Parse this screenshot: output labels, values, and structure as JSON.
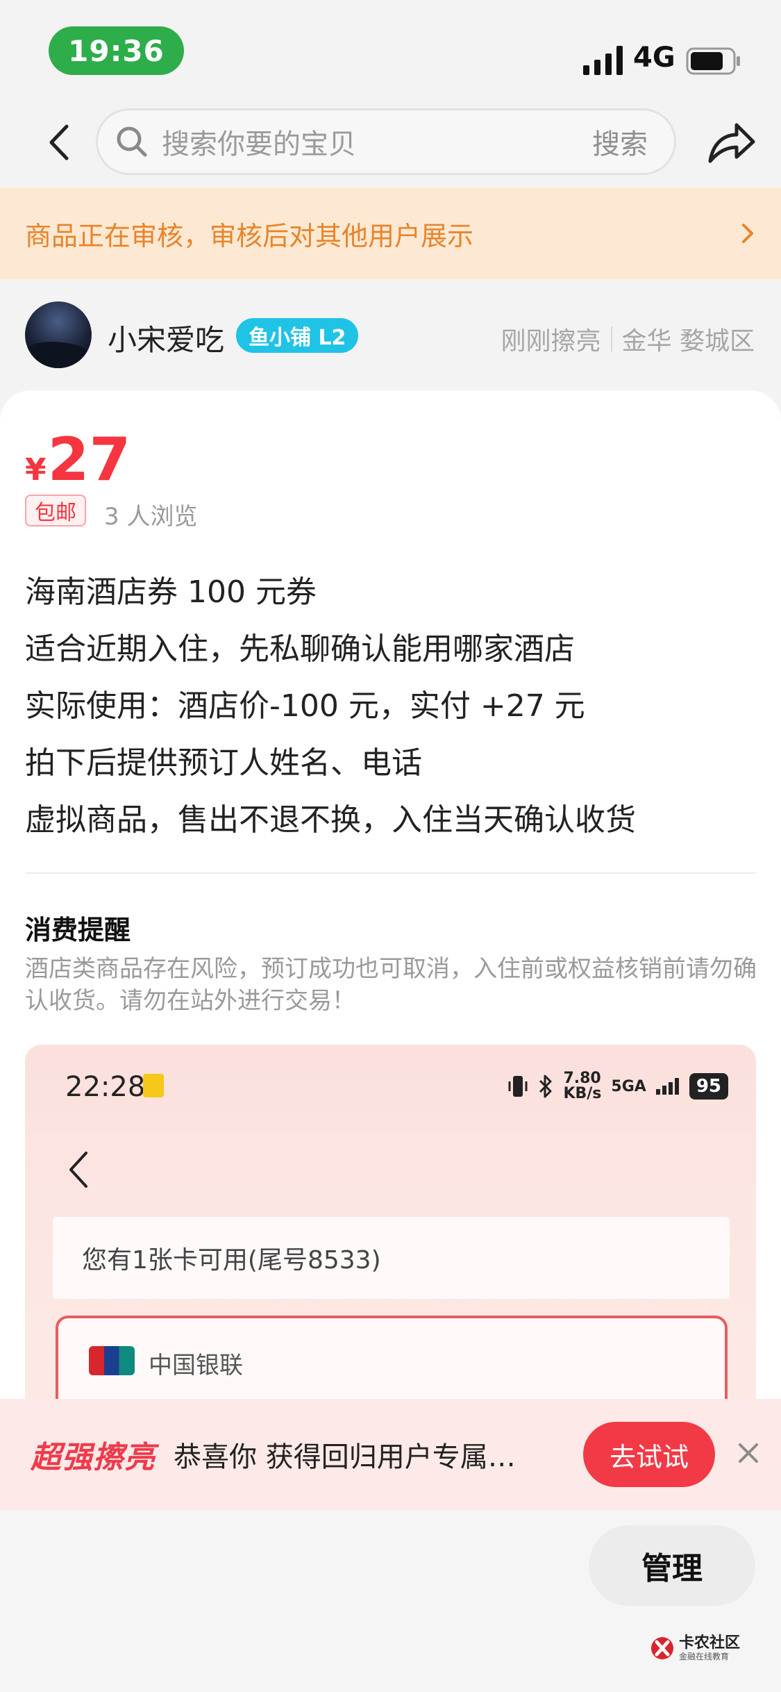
{
  "status_bar": {
    "time": "19:36",
    "network": "4G"
  },
  "search": {
    "placeholder": "搜索你要的宝贝",
    "action": "搜索"
  },
  "notice": {
    "text": "商品正在审核，审核后对其他用户展示"
  },
  "seller": {
    "name": "小宋爱吃",
    "badge": "鱼小铺 L2",
    "activity": "刚刚擦亮",
    "location": "金华 婺城区"
  },
  "item": {
    "currency": "¥",
    "price": "27",
    "shipping_tag": "包邮",
    "views": "3 人浏览",
    "description_lines": [
      "海南酒店券 100 元券",
      "适合近期入住，先私聊确认能用哪家酒店",
      "实际使用：酒店价-100 元，实付 +27 元",
      "拍下后提供预订人姓名、电话",
      "虚拟商品，售出不退不换，入住当天确认收货"
    ]
  },
  "reminder": {
    "title": "消费提醒",
    "text": "酒店类商品存在风险，预订成功也可取消，入住前或权益核销前请勿确认收货。请勿在站外进行交易！"
  },
  "screenshot": {
    "time": "22:28",
    "speed": "7.80",
    "speed_unit": "KB/s",
    "net": "5GA",
    "battery": "95",
    "card_text": "您有1张卡可用(尾号8533)",
    "bank_text": "中国银联"
  },
  "promo": {
    "brand": "超强擦亮",
    "text": "恭喜你 获得回归用户专属…",
    "button": "去试试"
  },
  "bottom": {
    "manage": "管理"
  },
  "watermark": {
    "title": "卡农社区",
    "subtitle": "金融在线教育"
  },
  "colors": {
    "price_red": "#f5353f",
    "notice_orange": "#e8842a",
    "badge_cyan": "#1fc3e6",
    "time_green": "#2ead4b"
  }
}
